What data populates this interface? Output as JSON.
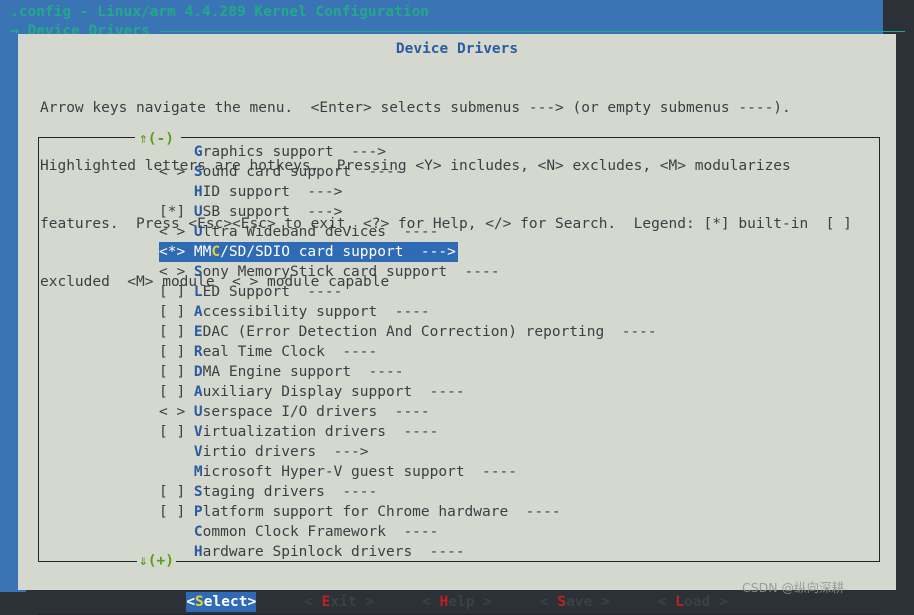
{
  "banner": {
    "title": ".config - Linux/arm 4.4.289 Kernel Configuration",
    "path": "→ Device Drivers"
  },
  "dialog": {
    "title": "Device Drivers",
    "help_lines": [
      "Arrow keys navigate the menu.  <Enter> selects submenus ---> (or empty submenus ----).",
      "Highlighted letters are hotkeys.  Pressing <Y> includes, <N> excludes, <M> modularizes",
      "features.  Press <Esc><Esc> to exit, <?> for Help, </> for Search.  Legend: [*] built-in  [ ]",
      "excluded  <M> module  < > module capable"
    ],
    "scroll_up": "⇑(-)",
    "scroll_down": "⇓(+)"
  },
  "menu": {
    "items": [
      {
        "prefix": "    ",
        "hot": "G",
        "pre": "",
        "post": "raphics support",
        "arrow": "  --->",
        "selected": false
      },
      {
        "prefix": "< > ",
        "hot": "S",
        "pre": "",
        "post": "ound card support",
        "arrow": "  ----",
        "selected": false
      },
      {
        "prefix": "    ",
        "hot": "H",
        "pre": "",
        "post": "ID support",
        "arrow": "  --->",
        "selected": false
      },
      {
        "prefix": "[*] ",
        "hot": "U",
        "pre": "",
        "post": "SB support",
        "arrow": "  --->",
        "selected": false
      },
      {
        "prefix": "< > ",
        "hot": "U",
        "pre": "",
        "post": "ltra Wideband devices",
        "arrow": "  ----",
        "selected": false
      },
      {
        "prefix": "<*> ",
        "hot": "C",
        "pre": "MM",
        "post": "/SD/SDIO card support",
        "arrow": "  --->",
        "selected": true
      },
      {
        "prefix": "< > ",
        "hot": "S",
        "pre": "",
        "post": "ony MemoryStick card support",
        "arrow": "  ----",
        "selected": false
      },
      {
        "prefix": "[ ] ",
        "hot": "L",
        "pre": "",
        "post": "ED Support",
        "arrow": "  ----",
        "selected": false
      },
      {
        "prefix": "[ ] ",
        "hot": "A",
        "pre": "",
        "post": "ccessibility support",
        "arrow": "  ----",
        "selected": false
      },
      {
        "prefix": "[ ] ",
        "hot": "E",
        "pre": "",
        "post": "DAC (Error Detection And Correction) reporting",
        "arrow": "  ----",
        "selected": false
      },
      {
        "prefix": "[ ] ",
        "hot": "R",
        "pre": "",
        "post": "eal Time Clock",
        "arrow": "  ----",
        "selected": false
      },
      {
        "prefix": "[ ] ",
        "hot": "D",
        "pre": "",
        "post": "MA Engine support",
        "arrow": "  ----",
        "selected": false
      },
      {
        "prefix": "[ ] ",
        "hot": "A",
        "pre": "",
        "post": "uxiliary Display support",
        "arrow": "  ----",
        "selected": false
      },
      {
        "prefix": "< > ",
        "hot": "U",
        "pre": "",
        "post": "serspace I/O drivers",
        "arrow": "  ----",
        "selected": false
      },
      {
        "prefix": "[ ] ",
        "hot": "V",
        "pre": "",
        "post": "irtualization drivers",
        "arrow": "  ----",
        "selected": false
      },
      {
        "prefix": "    ",
        "hot": "V",
        "pre": "",
        "post": "irtio drivers",
        "arrow": "  --->",
        "selected": false
      },
      {
        "prefix": "    ",
        "hot": "M",
        "pre": "",
        "post": "icrosoft Hyper-V guest support",
        "arrow": "  ----",
        "selected": false
      },
      {
        "prefix": "[ ] ",
        "hot": "S",
        "pre": "",
        "post": "taging drivers",
        "arrow": "  ----",
        "selected": false
      },
      {
        "prefix": "[ ] ",
        "hot": "P",
        "pre": "",
        "post": "latform support for Chrome hardware",
        "arrow": "  ----",
        "selected": false
      },
      {
        "prefix": "    ",
        "hot": "C",
        "pre": "",
        "post": "ommon Clock Framework",
        "arrow": "  ----",
        "selected": false
      },
      {
        "prefix": "    ",
        "hot": "H",
        "pre": "",
        "post": "ardware Spinlock drivers",
        "arrow": "  ----",
        "selected": false
      }
    ]
  },
  "buttons": [
    {
      "open": "<",
      "pre": "",
      "hot": "S",
      "post": "elect",
      "close": ">",
      "selected": true
    },
    {
      "open": "< ",
      "pre": "",
      "hot": "E",
      "post": "xit",
      "close": " >",
      "selected": false
    },
    {
      "open": "< ",
      "pre": "",
      "hot": "H",
      "post": "elp",
      "close": " >",
      "selected": false
    },
    {
      "open": "< ",
      "pre": "",
      "hot": "S",
      "post": "ave",
      "close": " >",
      "selected": false
    },
    {
      "open": "< ",
      "pre": "",
      "hot": "L",
      "post": "oad",
      "close": " >",
      "selected": false
    }
  ],
  "watermark": "CSDN @纵向深耕",
  "colors": {
    "backdrop": "#3b74b4",
    "dialog_bg": "#d4d8ce",
    "banner_text": "#22a98a",
    "title_text": "#2b5ba1",
    "body_text": "#3c4044",
    "hotkey": "#2b5ba1",
    "selection_bg": "#2f6ab4",
    "selection_hotkey": "#e8d132",
    "button_hotkey": "#c02020",
    "scroll_indicator": "#5a9e18",
    "shadow": "#2b3136"
  }
}
